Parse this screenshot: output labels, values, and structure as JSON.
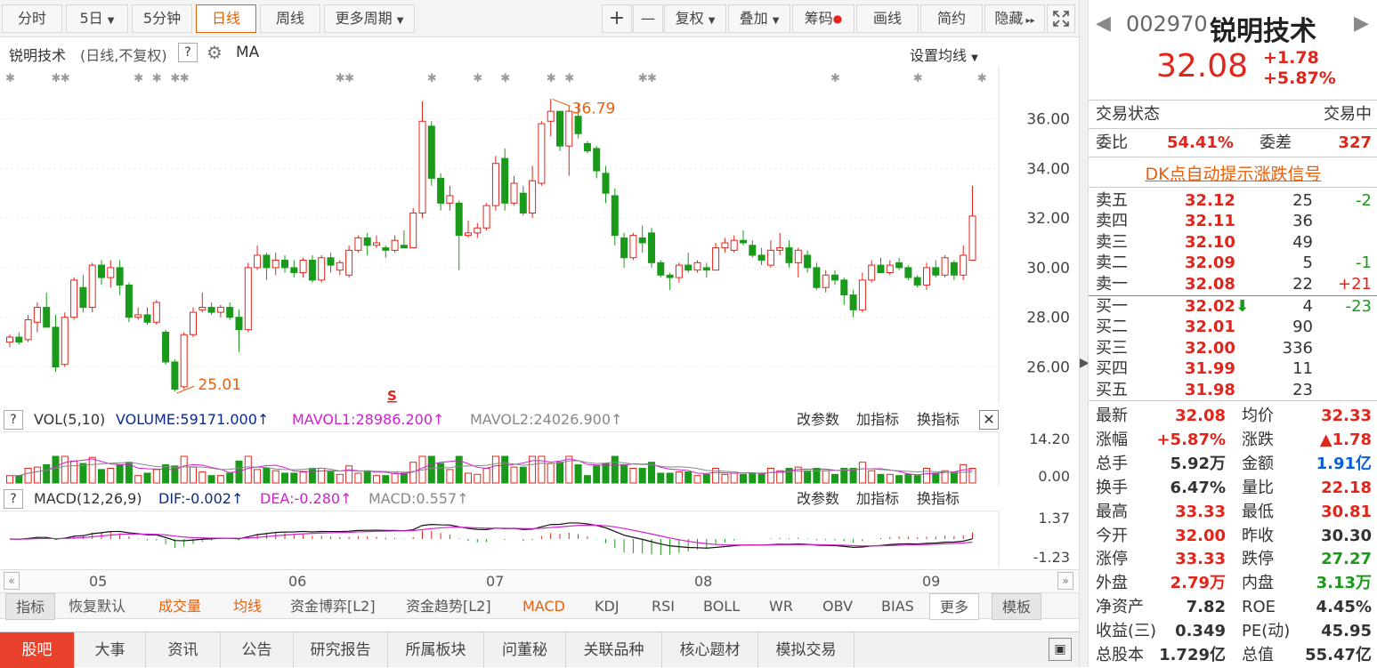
{
  "toolbar": {
    "periods": [
      "分时",
      "5日",
      "5分钟",
      "日线",
      "周线",
      "更多周期"
    ],
    "active_period": "日线",
    "tools": [
      "+",
      "—",
      "复权",
      "叠加",
      "筹码",
      "画线",
      "简约",
      "隐藏"
    ]
  },
  "chart_header": {
    "title": "锐明技术",
    "subtitle": "(日线,不复权)",
    "help": "?",
    "ma_label": "MA",
    "setting": "设置均线"
  },
  "price_axis": [
    "36.00",
    "34.00",
    "32.00",
    "30.00",
    "28.00",
    "26.00"
  ],
  "annotations": {
    "high": "36.79",
    "low": "25.01",
    "signal_mark": "S"
  },
  "chart_data": {
    "type": "candlestick",
    "ylim": [
      24.8,
      37.2
    ],
    "x_month_labels": [
      "05",
      "06",
      "07",
      "08",
      "09"
    ],
    "ohlc": [
      [
        27.0,
        27.3,
        26.8,
        27.2
      ],
      [
        27.2,
        27.4,
        26.9,
        27.0
      ],
      [
        27.1,
        28.1,
        27.0,
        27.9
      ],
      [
        27.8,
        28.6,
        27.4,
        28.4
      ],
      [
        28.4,
        29.0,
        27.6,
        27.6
      ],
      [
        27.6,
        28.1,
        25.8,
        26.0
      ],
      [
        26.1,
        28.2,
        26.0,
        28.0
      ],
      [
        28.0,
        29.6,
        27.9,
        29.5
      ],
      [
        29.2,
        29.7,
        28.2,
        28.4
      ],
      [
        28.4,
        30.2,
        28.2,
        30.1
      ],
      [
        30.1,
        30.3,
        29.3,
        29.6
      ],
      [
        29.6,
        30.3,
        29.2,
        30.0
      ],
      [
        30.0,
        30.3,
        28.9,
        29.3
      ],
      [
        29.3,
        29.4,
        27.8,
        28.0
      ],
      [
        28.0,
        28.4,
        27.9,
        28.1
      ],
      [
        28.1,
        28.4,
        27.7,
        27.8
      ],
      [
        27.8,
        28.7,
        27.7,
        28.6
      ],
      [
        27.4,
        27.5,
        26.1,
        26.2
      ],
      [
        26.2,
        26.3,
        25.0,
        25.1
      ],
      [
        25.2,
        27.4,
        25.1,
        27.3
      ],
      [
        27.3,
        28.4,
        27.2,
        28.2
      ],
      [
        28.3,
        29.0,
        28.2,
        28.4
      ],
      [
        28.4,
        28.6,
        28.1,
        28.2
      ],
      [
        28.2,
        28.5,
        28.0,
        28.4
      ],
      [
        28.4,
        28.6,
        27.9,
        28.0
      ],
      [
        28.0,
        28.3,
        26.6,
        27.5
      ],
      [
        27.5,
        30.2,
        27.4,
        30.0
      ],
      [
        30.0,
        30.9,
        29.9,
        30.5
      ],
      [
        30.5,
        30.6,
        29.5,
        30.0
      ],
      [
        30.0,
        30.6,
        29.7,
        30.3
      ],
      [
        30.3,
        30.5,
        29.8,
        30.0
      ],
      [
        30.0,
        30.3,
        29.6,
        29.8
      ],
      [
        29.8,
        30.4,
        29.6,
        30.3
      ],
      [
        30.3,
        30.5,
        29.4,
        29.5
      ],
      [
        29.5,
        30.5,
        29.4,
        30.4
      ],
      [
        30.4,
        30.6,
        29.8,
        30.1
      ],
      [
        29.9,
        30.3,
        29.7,
        30.2
      ],
      [
        29.7,
        30.9,
        29.6,
        30.7
      ],
      [
        30.7,
        31.3,
        30.6,
        31.2
      ],
      [
        31.2,
        31.4,
        30.5,
        30.9
      ],
      [
        30.9,
        31.3,
        30.8,
        31.0
      ],
      [
        30.8,
        30.9,
        30.4,
        30.7
      ],
      [
        30.7,
        31.3,
        30.6,
        31.1
      ],
      [
        30.9,
        31.5,
        30.8,
        30.8
      ],
      [
        30.8,
        32.4,
        30.8,
        32.2
      ],
      [
        32.2,
        36.7,
        32.0,
        35.9
      ],
      [
        35.7,
        35.9,
        33.3,
        33.6
      ],
      [
        33.6,
        33.8,
        32.3,
        32.6
      ],
      [
        32.6,
        33.3,
        32.3,
        32.9
      ],
      [
        32.6,
        32.7,
        29.9,
        31.3
      ],
      [
        31.3,
        31.9,
        31.2,
        31.4
      ],
      [
        31.4,
        31.8,
        31.2,
        31.6
      ],
      [
        31.6,
        32.6,
        31.5,
        32.5
      ],
      [
        32.5,
        34.5,
        32.3,
        34.2
      ],
      [
        34.4,
        34.8,
        32.3,
        32.6
      ],
      [
        32.6,
        33.7,
        32.5,
        33.4
      ],
      [
        33.0,
        33.3,
        32.1,
        32.2
      ],
      [
        32.2,
        34.1,
        32.0,
        33.5
      ],
      [
        33.4,
        35.9,
        33.3,
        35.8
      ],
      [
        35.9,
        36.8,
        35.3,
        36.3
      ],
      [
        36.3,
        36.3,
        34.7,
        34.9
      ],
      [
        34.9,
        36.5,
        33.7,
        36.3
      ],
      [
        36.1,
        36.6,
        35.2,
        35.4
      ],
      [
        35.0,
        35.1,
        34.6,
        34.7
      ],
      [
        34.8,
        34.9,
        33.6,
        33.9
      ],
      [
        33.8,
        34.1,
        32.6,
        33.0
      ],
      [
        32.9,
        33.2,
        30.9,
        31.3
      ],
      [
        31.2,
        31.4,
        30.0,
        30.4
      ],
      [
        30.4,
        31.4,
        30.3,
        31.3
      ],
      [
        31.2,
        31.7,
        30.6,
        31.0
      ],
      [
        31.4,
        31.6,
        30.0,
        30.2
      ],
      [
        30.2,
        30.3,
        29.6,
        29.7
      ],
      [
        29.7,
        29.8,
        29.1,
        29.6
      ],
      [
        29.6,
        30.2,
        29.4,
        30.1
      ],
      [
        30.1,
        30.6,
        29.8,
        29.9
      ],
      [
        29.9,
        30.3,
        29.8,
        30.2
      ],
      [
        30.0,
        30.2,
        29.6,
        29.9
      ],
      [
        29.9,
        31.0,
        29.9,
        30.8
      ],
      [
        30.8,
        31.2,
        30.6,
        31.0
      ],
      [
        30.7,
        31.3,
        30.6,
        31.1
      ],
      [
        31.1,
        31.5,
        30.9,
        31.0
      ],
      [
        30.9,
        31.1,
        30.4,
        30.5
      ],
      [
        30.5,
        30.8,
        30.1,
        30.3
      ],
      [
        30.1,
        31.1,
        30.0,
        30.7
      ],
      [
        30.7,
        31.4,
        30.5,
        30.8
      ],
      [
        30.8,
        31.1,
        30.0,
        30.2
      ],
      [
        30.2,
        30.8,
        29.6,
        30.7
      ],
      [
        30.5,
        30.7,
        29.8,
        30.0
      ],
      [
        30.0,
        30.2,
        29.1,
        29.2
      ],
      [
        29.2,
        29.9,
        29.0,
        29.7
      ],
      [
        29.7,
        29.9,
        29.3,
        29.5
      ],
      [
        29.5,
        29.6,
        28.5,
        28.9
      ],
      [
        28.9,
        29.1,
        28.0,
        28.3
      ],
      [
        28.3,
        29.8,
        28.2,
        29.5
      ],
      [
        29.5,
        30.3,
        29.4,
        30.1
      ],
      [
        30.1,
        30.4,
        29.8,
        29.8
      ],
      [
        29.8,
        30.3,
        29.7,
        30.1
      ],
      [
        30.2,
        30.4,
        29.9,
        30.0
      ],
      [
        30.0,
        30.1,
        29.5,
        29.6
      ],
      [
        29.6,
        29.7,
        29.2,
        29.3
      ],
      [
        29.3,
        30.2,
        29.1,
        30.0
      ],
      [
        30.0,
        30.3,
        29.6,
        29.7
      ],
      [
        29.7,
        30.5,
        29.6,
        30.4
      ],
      [
        30.2,
        30.3,
        29.5,
        29.7
      ],
      [
        29.7,
        30.9,
        29.5,
        30.5
      ],
      [
        30.3,
        33.3,
        30.8,
        32.08
      ]
    ],
    "volume_axis": [
      "14.20",
      "0.00"
    ],
    "macd_axis": [
      "1.37",
      "-1.23"
    ]
  },
  "vol_indicator": {
    "help": "?",
    "name": "VOL(5,10)",
    "volume": "VOLUME:59171.000",
    "mavol1": "MAVOL1:28986.200",
    "mavol2": "MAVOL2:24026.900",
    "actions": [
      "改参数",
      "加指标",
      "换指标"
    ]
  },
  "macd_indicator": {
    "help": "?",
    "name": "MACD(12,26,9)",
    "dif": "DIF:-0.002",
    "dea": "DEA:-0.280",
    "macd": "MACD:0.557",
    "actions": [
      "改参数",
      "加指标",
      "换指标"
    ]
  },
  "indicator_tabs": [
    "指标",
    "恢复默认",
    "成交量",
    "均线",
    "资金博弈[L2]",
    "资金趋势[L2]",
    "MACD",
    "KDJ",
    "RSI",
    "BOLL",
    "WR",
    "OBV",
    "BIAS",
    "更多",
    "模板"
  ],
  "bottom_tabs": [
    "股吧",
    "大事",
    "资讯",
    "公告",
    "研究报告",
    "所属板块",
    "问董秘",
    "关联品种",
    "核心题材",
    "模拟交易"
  ],
  "quote": {
    "code": "002970",
    "name": "锐明技术",
    "price": "32.08",
    "change": "+1.78",
    "change_pct": "+5.87%",
    "status_label": "交易状态",
    "status": "交易中",
    "weibi_label": "委比",
    "weibi": "54.41%",
    "weicha_label": "委差",
    "weicha": "327",
    "dk_link": "DK点自动提示涨跌信号",
    "asks": [
      {
        "label": "卖五",
        "price": "32.12",
        "vol": "25",
        "chg": "-2"
      },
      {
        "label": "卖四",
        "price": "32.11",
        "vol": "36",
        "chg": ""
      },
      {
        "label": "卖三",
        "price": "32.10",
        "vol": "49",
        "chg": ""
      },
      {
        "label": "卖二",
        "price": "32.09",
        "vol": "5",
        "chg": "-1"
      },
      {
        "label": "卖一",
        "price": "32.08",
        "vol": "22",
        "chg": "+21"
      }
    ],
    "bids": [
      {
        "label": "买一",
        "price": "32.02",
        "vol": "4",
        "chg": "-23"
      },
      {
        "label": "买二",
        "price": "32.01",
        "vol": "90",
        "chg": ""
      },
      {
        "label": "买三",
        "price": "32.00",
        "vol": "336",
        "chg": ""
      },
      {
        "label": "买四",
        "price": "31.99",
        "vol": "11",
        "chg": ""
      },
      {
        "label": "买五",
        "price": "31.98",
        "vol": "23",
        "chg": ""
      }
    ],
    "stats": [
      {
        "l1": "最新",
        "v1": "32.08",
        "c1": "red",
        "l2": "均价",
        "v2": "32.33",
        "c2": "red"
      },
      {
        "l1": "涨幅",
        "v1": "+5.87%",
        "c1": "red",
        "l2": "涨跌",
        "v2": "▲1.78",
        "c2": "red"
      },
      {
        "l1": "总手",
        "v1": "5.92万",
        "c1": "",
        "l2": "金额",
        "v2": "1.91亿",
        "c2": "blue"
      },
      {
        "l1": "换手",
        "v1": "6.47%",
        "c1": "",
        "l2": "量比",
        "v2": "22.18",
        "c2": "red"
      },
      {
        "l1": "最高",
        "v1": "33.33",
        "c1": "red",
        "l2": "最低",
        "v2": "30.81",
        "c2": "red"
      },
      {
        "l1": "今开",
        "v1": "32.00",
        "c1": "red",
        "l2": "昨收",
        "v2": "30.30",
        "c2": ""
      },
      {
        "l1": "涨停",
        "v1": "33.33",
        "c1": "red",
        "l2": "跌停",
        "v2": "27.27",
        "c2": "green"
      },
      {
        "l1": "外盘",
        "v1": "2.79万",
        "c1": "red",
        "l2": "内盘",
        "v2": "3.13万",
        "c2": "green"
      },
      {
        "l1": "净资产",
        "v1": "7.82",
        "c1": "",
        "l2": "ROE",
        "v2": "4.45%",
        "c2": ""
      },
      {
        "l1": "收益(三)",
        "v1": "0.349",
        "c1": "",
        "l2": "PE(动)",
        "v2": "45.95",
        "c2": ""
      },
      {
        "l1": "总股本",
        "v1": "1.729亿",
        "c1": "",
        "l2": "总值",
        "v2": "55.47亿",
        "c2": ""
      }
    ]
  },
  "colors": {
    "up": "#e1251b",
    "down": "#1a9a1a",
    "accent": "#e8600a",
    "ma_purple": "#d020d0"
  }
}
